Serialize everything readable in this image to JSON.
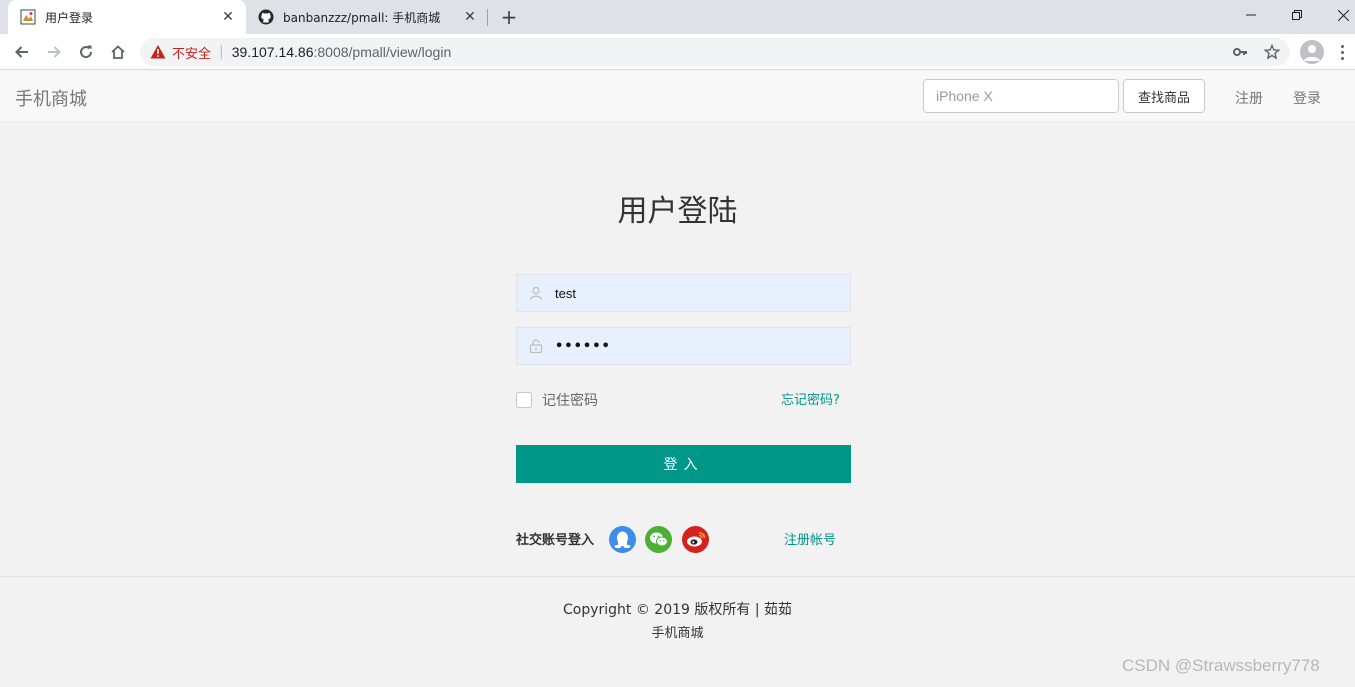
{
  "browser": {
    "tabs": [
      {
        "title": "用户登录",
        "icon": "site-favicon-icon",
        "active": true
      },
      {
        "title": "banbanzzz/pmall: 手机商城",
        "icon": "github-icon",
        "active": false
      }
    ],
    "new_tab_icon": "plus-icon",
    "window_controls": [
      "minimize-icon",
      "restore-icon",
      "close-icon"
    ],
    "nav_icons": [
      "back-arrow-icon",
      "forward-arrow-icon",
      "reload-icon",
      "home-icon"
    ],
    "security_label": "不安全",
    "url_host": "39.107.14.86",
    "url_rest": ":8008/pmall/view/login",
    "omnibox_icons": [
      "key-icon",
      "star-icon"
    ],
    "profile_icon": "profile-avatar-icon",
    "menu_icon": "kebab-menu-icon"
  },
  "header": {
    "brand": "手机商城",
    "search_placeholder": "iPhone X",
    "search_button": "查找商品",
    "nav": {
      "register": "注册",
      "login": "登录"
    }
  },
  "login": {
    "title": "用户登陆",
    "username": {
      "value": "test",
      "icon": "user-icon"
    },
    "password": {
      "masked": "••••••",
      "icon": "lock-icon"
    },
    "remember_label": "记住密码",
    "remember_checked": false,
    "forgot_link": "忘记密码?",
    "submit": "登入",
    "social_label": "社交账号登入",
    "social_icons": [
      "qq-icon",
      "wechat-icon",
      "weibo-icon"
    ],
    "register_link": "注册帐号"
  },
  "footer": {
    "copyright": "Copyright © 2019 版权所有 | 茹茹",
    "site": "手机商城"
  },
  "watermark": "CSDN @Strawssberry778",
  "colors": {
    "accent": "#009688",
    "autofill": "#e8f0fe",
    "qq": "#3d8ee8",
    "wechat": "#4cb033",
    "weibo": "#d5221c"
  }
}
